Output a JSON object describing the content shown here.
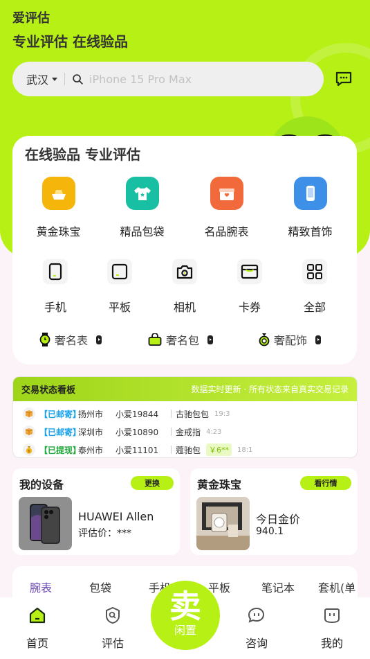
{
  "header": {
    "app_title": "爱评估",
    "slogan": "专业评估 在线验品"
  },
  "search": {
    "city": "武汉",
    "placeholder": "iPhone 15 Pro Max"
  },
  "main_card": {
    "title": "在线验品 专业评估",
    "big_categories": [
      {
        "label": "黄金珠宝",
        "icon": "gold-ingot-icon",
        "color": "#f5b50a"
      },
      {
        "label": "精品包袋",
        "icon": "tshirt-icon",
        "color": "#18bfa3"
      },
      {
        "label": "名品腕表",
        "icon": "gift-icon",
        "color": "#f26a3c"
      },
      {
        "label": "精致首饰",
        "icon": "phone-icon",
        "color": "#3d8fe8"
      }
    ],
    "small_categories": [
      {
        "label": "手机",
        "icon": "phone-icon"
      },
      {
        "label": "平板",
        "icon": "tablet-icon"
      },
      {
        "label": "相机",
        "icon": "camera-icon"
      },
      {
        "label": "卡券",
        "icon": "card-icon"
      },
      {
        "label": "全部",
        "icon": "grid-icon"
      }
    ],
    "pills": [
      {
        "label": "奢名表",
        "icon": "watch-icon"
      },
      {
        "label": "奢名包",
        "icon": "bag-icon"
      },
      {
        "label": "奢配饰",
        "icon": "ring-icon"
      }
    ]
  },
  "board": {
    "title": "交易状态看板",
    "subtitle": "数据实时更新 · 所有状态来自真实交易记录",
    "rows": [
      {
        "status": "【已邮寄】",
        "city": "扬州市",
        "user": "小爱19844",
        "item": "古驰包包",
        "price": "",
        "time": "19:3"
      },
      {
        "status": "【已邮寄】",
        "city": "深圳市",
        "user": "小爱10890",
        "item": "金戒指",
        "price": "",
        "time": "4:23"
      },
      {
        "status": "【已提现】",
        "city": "泰州市",
        "user": "小爱11101",
        "item": "蔻驰包",
        "price": "￥6**",
        "time": "18:1"
      }
    ]
  },
  "device_panel": {
    "title": "我的设备",
    "button": "更换",
    "name": "HUAWEI Allen",
    "value": "评估价：***"
  },
  "gold_panel": {
    "title": "黄金珠宝",
    "button": "看行情",
    "name": "今日金价",
    "value": "940.1"
  },
  "category_tabs": [
    "腕表",
    "包袋",
    "手机",
    "平板",
    "笔记本",
    "套机(单"
  ],
  "tabbar": {
    "home": "首页",
    "evaluate": "评估",
    "sell_big": "卖",
    "sell_small": "闲置",
    "consult": "咨询",
    "mine": "我的"
  },
  "colors": {
    "accent": "#b6f014",
    "active_tab": "#6a48b8",
    "status_mail": "#19a1ea",
    "status_cash": "#21a83a"
  }
}
